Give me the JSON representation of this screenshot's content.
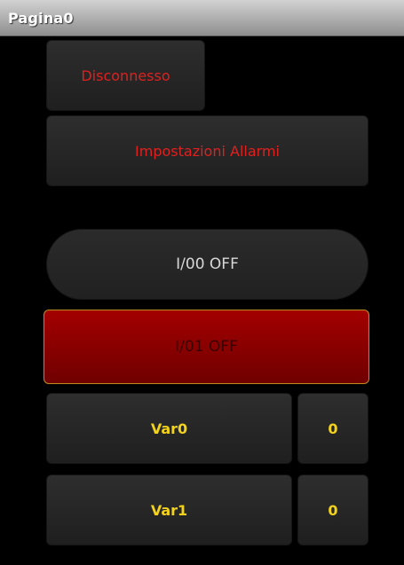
{
  "window": {
    "title": "Pagina0"
  },
  "buttons": {
    "disconnect": "Disconnesso",
    "alarm_settings": "Impostazioni Allarmi",
    "io00": "I/00 OFF",
    "io01": "I/01 OFF"
  },
  "vars": [
    {
      "label": "Var0",
      "value": "0"
    },
    {
      "label": "Var1",
      "value": "0"
    }
  ],
  "colors": {
    "title_text": "#ffffff",
    "red_text": "#e0201e",
    "yellow_text": "#f3d21b",
    "active_red": "#a30000"
  }
}
